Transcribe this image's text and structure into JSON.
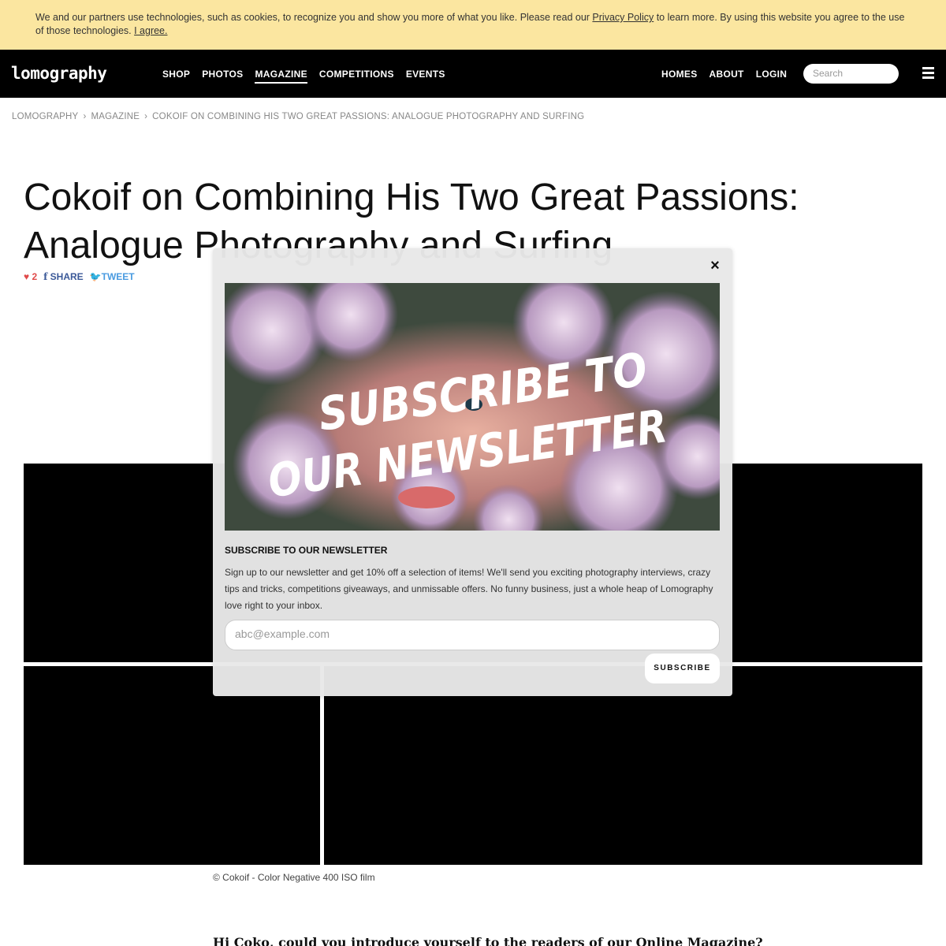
{
  "cookie": {
    "text_before": "We and our partners use technologies, such as cookies, to recognize you and show you more of what you like. Please read our ",
    "privacy_link": "Privacy Policy",
    "text_after": " to learn more. By using this website you agree to the use of those technologies. ",
    "agree_link": "I agree."
  },
  "nav": {
    "logo": "lomography",
    "links": [
      "SHOP",
      "PHOTOS",
      "MAGAZINE",
      "COMPETITIONS",
      "EVENTS"
    ],
    "active": "MAGAZINE",
    "right_links": [
      "HOMES",
      "ABOUT",
      "LOGIN"
    ],
    "search_placeholder": "Search"
  },
  "breadcrumb": [
    "LOMOGRAPHY",
    "MAGAZINE",
    "COKOIF ON COMBINING HIS TWO GREAT PASSIONS: ANALOGUE PHOTOGRAPHY AND SURFING"
  ],
  "article": {
    "title": "Cokoif on Combining His Two Great Passions: Analogue Photography and Surfing",
    "likes": "2",
    "share_label": "SHARE",
    "tweet_label": "TWEET",
    "caption": "© Cokoif - Color Negative 400 ISO film",
    "question": "Hi Coko, could you introduce yourself to the readers of our Online Magazine?"
  },
  "modal": {
    "hero_line1": "SUBSCRIBE TO",
    "hero_line2": "OUR NEWSLETTER",
    "heading": "SUBSCRIBE TO OUR NEWSLETTER",
    "body": "Sign up to our newsletter and get 10% off a selection of items! We'll send you exciting photography interviews, crazy tips and tricks, competitions giveaways, and unmissable offers. No funny business, just a whole heap of Lomography love right to your inbox.",
    "email_placeholder": "abc@example.com",
    "subscribe_label": "SUBSCRIBE",
    "close_glyph": "×"
  },
  "colors": {
    "cookie_bg": "#fbe6a0",
    "nav_bg": "#000000",
    "like_red": "#e04a4a",
    "facebook_blue": "#3b5998",
    "twitter_blue": "#4a9be0"
  }
}
